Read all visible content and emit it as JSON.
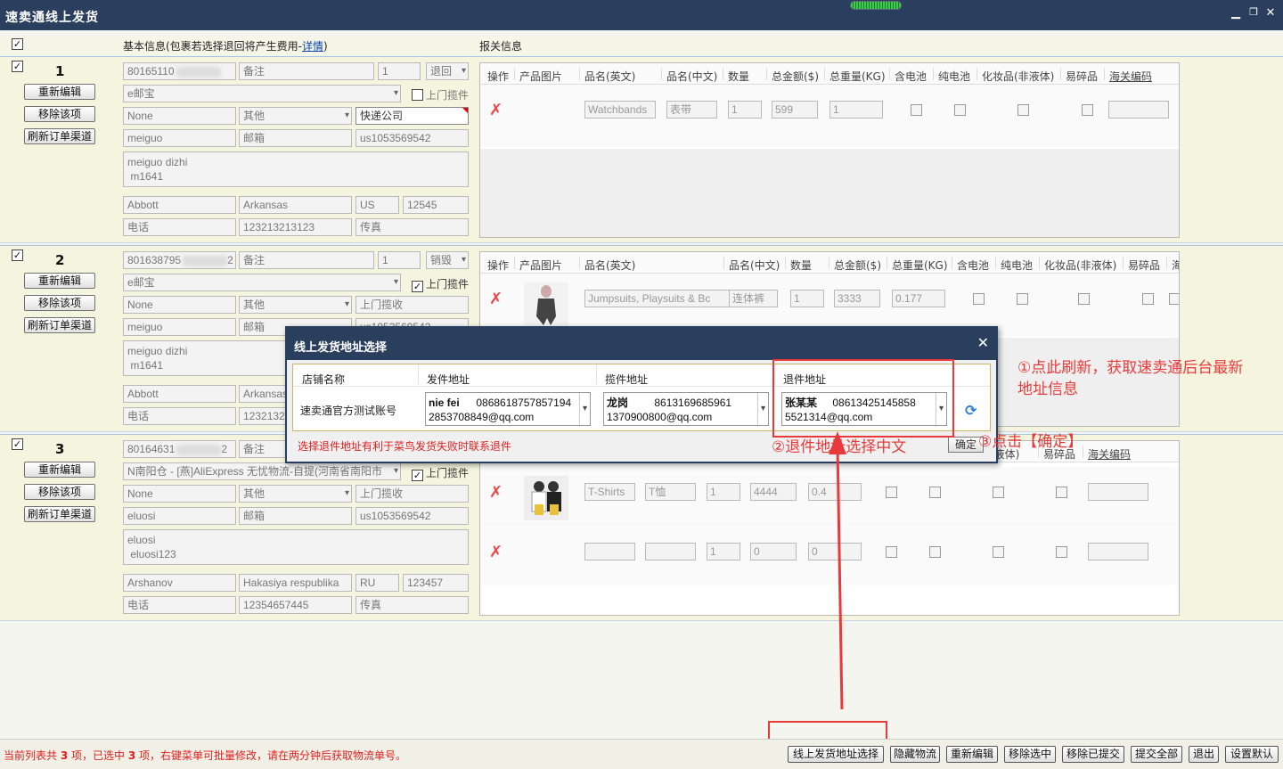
{
  "app": {
    "title": "速卖通线上发货"
  },
  "header": {
    "basic_info_label": "基本信息(包裹若选择退回将产生费用-",
    "detail_link": "详情",
    "basic_info_suffix": ")",
    "customs_label": "报关信息"
  },
  "orders": [
    {
      "num": "1",
      "buttons": [
        "重新编辑",
        "移除该项",
        "刷新订单渠道"
      ],
      "order_id_prefix": "80165110",
      "order_id_suffix": "",
      "remark_placeholder": "备注",
      "qty": "1",
      "action_select": "退回",
      "logistics": "e邮宝",
      "pickup_label": "上门揽件",
      "pickup_checked": false,
      "none": "None",
      "other": "其他",
      "carrier": "快递公司",
      "country_code": "meiguo",
      "postal_label": "邮箱",
      "email": "us1053569542",
      "address": "meiguo dizhi\n m1641",
      "city": "Abbott",
      "state": "Arkansas",
      "country": "US",
      "zip": "12545",
      "phone_label": "电话",
      "phone": "123213213123",
      "fax_label": "传真",
      "decl_headers": [
        "操作",
        "产品图片",
        "品名(英文)",
        "品名(中文)",
        "数量",
        "总金额($)",
        "总重量(KG)",
        "含电池",
        "纯电池",
        "化妆品(非液体)",
        "易碎品",
        "海关编码"
      ],
      "items": [
        {
          "en": "Watchbands",
          "cn": "表带",
          "qty": "1",
          "amount": "599",
          "weight": "1",
          "has_image": false
        }
      ]
    },
    {
      "num": "2",
      "buttons": [
        "重新编辑",
        "移除该项",
        "刷新订单渠道"
      ],
      "order_id_prefix": "801638795",
      "order_id_suffix": "2",
      "remark_placeholder": "备注",
      "qty": "1",
      "action_select": "销毁",
      "logistics": "e邮宝",
      "pickup_label": "上门揽件",
      "pickup_checked": true,
      "none": "None",
      "other": "其他",
      "carrier": "上门揽收",
      "country_code": "meiguo",
      "postal_label": "邮箱",
      "email": "us1053569542",
      "address": "meiguo dizhi\n m1641",
      "city": "Abbott",
      "state": "Arkansas",
      "country": "",
      "zip": "",
      "phone_label": "电话",
      "phone": "1232132",
      "fax_label": "传真",
      "decl_headers": [
        "操作",
        "产品图片",
        "品名(英文)",
        "品名(中文)",
        "数量",
        "总金额($)",
        "总重量(KG)",
        "含电池",
        "纯电池",
        "化妆品(非液体)",
        "易碎品",
        "海"
      ],
      "items": [
        {
          "en": "Jumpsuits, Playsuits & Bc",
          "cn": "连体裤",
          "qty": "1",
          "amount": "3333",
          "weight": "0.177",
          "has_image": true
        }
      ]
    },
    {
      "num": "3",
      "buttons": [
        "重新编辑",
        "移除该项",
        "刷新订单渠道"
      ],
      "order_id_prefix": "80164631",
      "order_id_suffix": "2",
      "remark_placeholder": "备注",
      "qty": "",
      "action_select": "",
      "logistics": "N南阳仓 - [燕]AliExpress 无忧物流-自提(河南省南阳市",
      "pickup_label": "上门揽件",
      "pickup_checked": true,
      "none": "None",
      "other": "其他",
      "carrier": "上门揽收",
      "country_code": "eluosi",
      "postal_label": "邮箱",
      "email": "us1053569542",
      "address": "eluosi\n eluosi123",
      "city": "Arshanov",
      "state": "Hakasiya respublika",
      "country": "RU",
      "zip": "123457",
      "phone_label": "电话",
      "phone": "12354657445",
      "fax_label": "传真",
      "decl_headers": [
        "(非液体)",
        "易碎品",
        "海关编码"
      ],
      "items": [
        {
          "en": "T-Shirts",
          "cn": "T恤",
          "qty": "1",
          "amount": "4444",
          "weight": "0.4",
          "has_image": true
        },
        {
          "en": "",
          "cn": "",
          "qty": "1",
          "amount": "0",
          "weight": "0",
          "has_image": false
        }
      ]
    }
  ],
  "modal": {
    "title": "线上发货地址选择",
    "headers": [
      "店铺名称",
      "发件地址",
      "揽件地址",
      "退件地址"
    ],
    "store": "速卖通官方测试账号",
    "sender": {
      "name": "nie fei",
      "phone": "0868618757857194",
      "email": "2853708849@qq.com"
    },
    "pickup": {
      "name": "龙岗",
      "phone": "8613169685961",
      "email": "1370900800@qq.com"
    },
    "returns": {
      "name": "张某某",
      "phone": "08613425145858",
      "email": "5521314@qq.com"
    },
    "hint": "选择退件地址有利于菜鸟发货失败时联系退件",
    "ok": "确定"
  },
  "annotations": {
    "a1": "①点此刷新，获取速卖通后台最新",
    "a1b": "地址信息",
    "a2": "②退件地址选择中文",
    "a3": "③点击【确定】"
  },
  "footer": {
    "status_pre": "当前列表共 ",
    "total": "3",
    "status_mid": " 项，已选中 ",
    "selected": "3",
    "status_post": " 项，右键菜单可批量修改，请在两分钟后获取物流单号。",
    "buttons": [
      "线上发货地址选择",
      "隐藏物流",
      "重新编辑",
      "移除选中",
      "移除已提交",
      "提交全部",
      "退出",
      "设置默认"
    ]
  },
  "colors": {
    "titlebar": "#2a3e5e",
    "annotation": "#e83a3a",
    "status": "#e02020"
  }
}
